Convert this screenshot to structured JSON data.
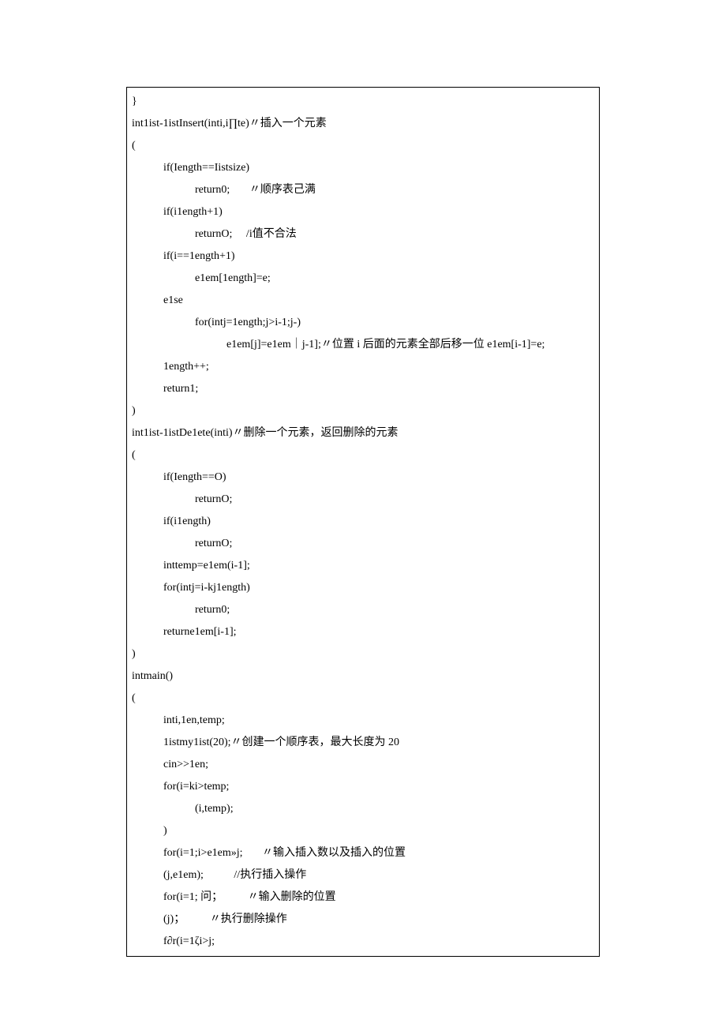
{
  "code": {
    "l01": "}",
    "l02": "",
    "l03": "int1ist-1istInsert(inti,i∏te)〃插入一个元素",
    "l04": "(",
    "l05": "if(Iength==Iistsize)",
    "l06": "return0;       〃顺序表己满",
    "l07": "if(i1ength+1)",
    "l08": "returnO;     /i值不合法",
    "l09": "if(i==1ength+1)",
    "l10": "e1em[1ength]=e;",
    "l11": "e1se",
    "l12": "for(intj=1ength;j>i-1;j-)",
    "l13": "e1em[j]=e1em｜j-1];〃位置 i 后面的元素全部后移一位 e1em[i-1]=e;",
    "l14": "1ength++;",
    "l15": "return1;",
    "l16": ")",
    "l17": "",
    "l18": "int1ist-1istDe1ete(inti)〃删除一个元素，返回删除的元素",
    "l19": "(",
    "l20": "if(Iength==O)",
    "l21": "returnO;",
    "l22": "if(i1ength)",
    "l23": "returnO;",
    "l24": "inttemp=e1em(i-1];",
    "l25": "for(intj=i-kj1ength)",
    "l26": "return0;",
    "l27": "returne1em[i-1];",
    "l28": ")",
    "l29": "",
    "l30": "intmain()",
    "l31": "(",
    "l32": "inti,1en,temp;",
    "l33": "1istmy1ist(20);〃创建一个顺序表，最大长度为 20",
    "l34": "cin>>1en;",
    "l35": "for(i=ki>temp;",
    "l36": "(i,temp);",
    "l37": ")",
    "l38": "for(i=1;i>e1em»j;       〃输入插入数以及插入的位置",
    "l39": "(j,e1em);           //执行插入操作",
    "l40": "for(i=1; 问；         〃输入删除的位置",
    "l41": "(j)；         〃执行删除操作",
    "l42": "f∂r(i=1ζi>j;"
  }
}
